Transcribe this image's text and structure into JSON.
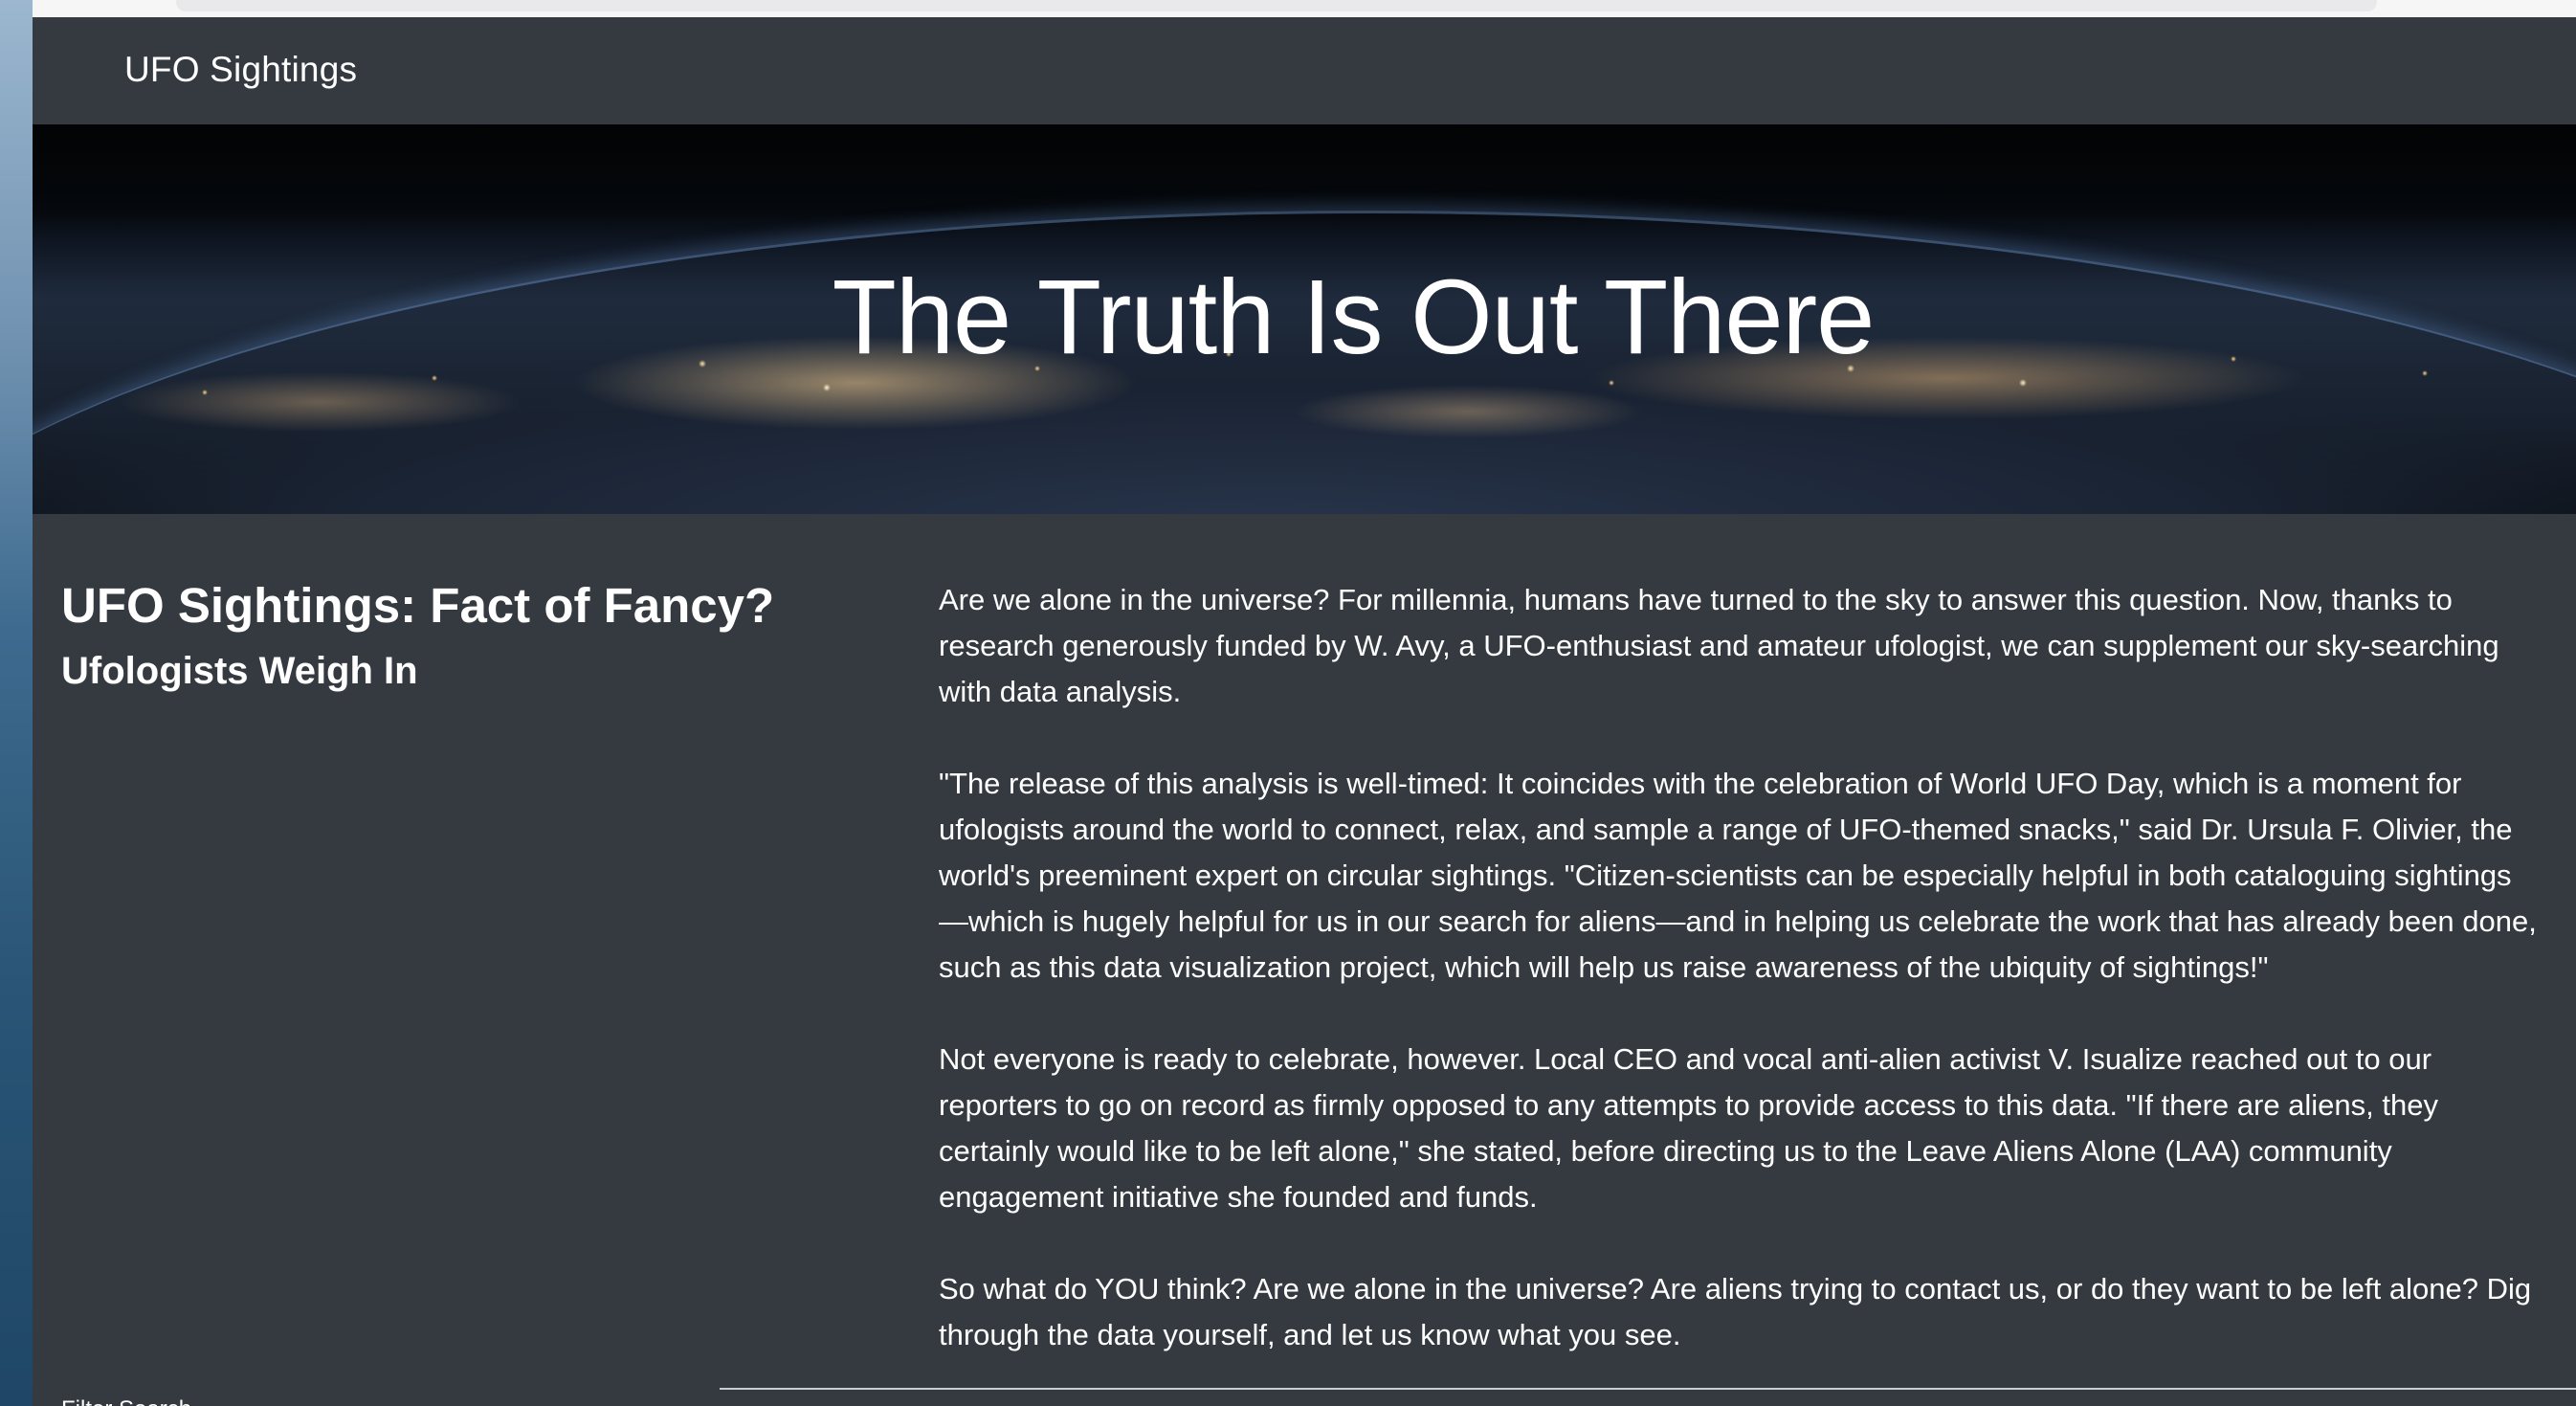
{
  "navbar": {
    "brand": "UFO Sightings"
  },
  "hero": {
    "title": "The Truth Is Out There"
  },
  "intro": {
    "heading": "UFO Sightings: Fact of Fancy?",
    "subheading": "Ufologists Weigh In"
  },
  "article": {
    "paragraphs": [
      [
        "Are we alone in the universe? For millennia, humans have turned to the sky to answer this question. Now, thanks to",
        "research generously funded by W. Avy, a UFO-enthusiast and amateur ufologist, we can supplement our sky-searching",
        "with data analysis."
      ],
      [
        "\"The release of this analysis is well-timed: It coincides with the celebration of World UFO Day, which is a moment for",
        "ufologists around the world to connect, relax, and sample a range of UFO-themed snacks,\" said Dr. Ursula F. Olivier, the",
        "world's preeminent expert on circular sightings. \"Citizen-scientists can be especially helpful in both cataloguing sightings",
        "—which is hugely helpful for us in our search for aliens—and in helping us celebrate the work that has already been done,",
        "such as this data visualization project, which will help us raise awareness of the ubiquity of sightings!\""
      ],
      [
        "Not everyone is ready to celebrate, however. Local CEO and vocal anti-alien activist V. Isualize reached out to our",
        "reporters to go on record as firmly opposed to any attempts to provide access to this data. \"If there are aliens, they",
        "certainly would like to be left alone,\" she stated, before directing us to the Leave Aliens Alone (LAA) community",
        "engagement initiative she founded and funds."
      ],
      [
        "So what do YOU think? Are we alone in the universe? Are aliens trying to contact us, or do they want to be left alone? Dig",
        "through the data yourself, and let us know what you see."
      ]
    ]
  },
  "footer": {
    "cutoff_label": "Filter Search"
  }
}
